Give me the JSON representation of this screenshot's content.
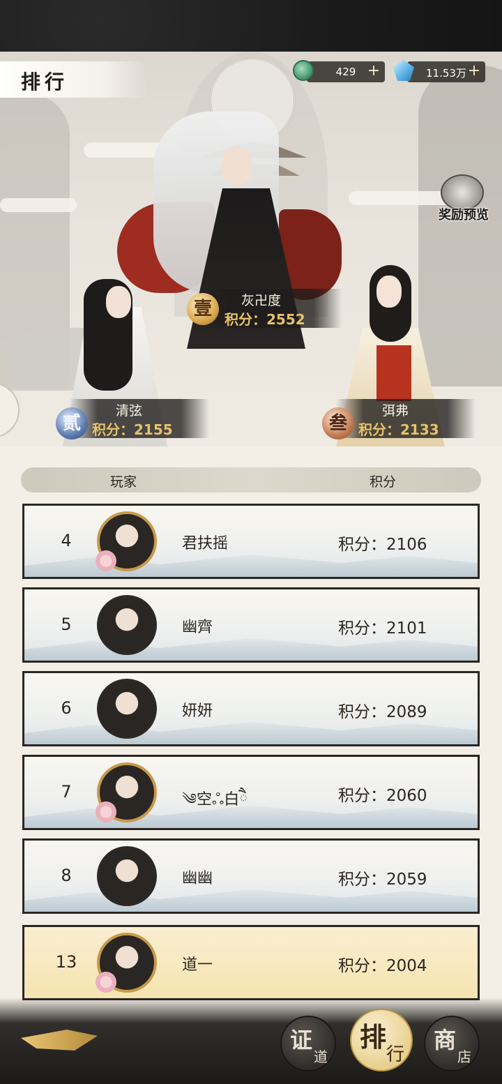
{
  "header": {
    "title": "排行"
  },
  "currencies": [
    {
      "icon": "jade-token-icon",
      "value": "429",
      "add": "+"
    },
    {
      "icon": "blue-crystal-icon",
      "value": "11.53万",
      "add": "+"
    }
  ],
  "reward_preview": {
    "label": "奖励预览",
    "icon": "gift-bag-icon"
  },
  "podium": [
    {
      "rank_glyph": "壹",
      "name": "灰卍度",
      "score": "积分：2552"
    },
    {
      "rank_glyph": "贰",
      "name": "清弦",
      "score": "积分：2155"
    },
    {
      "rank_glyph": "叁",
      "name": "弭弗",
      "score": "积分：2133"
    }
  ],
  "table": {
    "col_player": "玩家",
    "col_score": "积分",
    "rows": [
      {
        "rank": "4",
        "name": "君扶摇",
        "score_label": "积分：",
        "score": "2106"
      },
      {
        "rank": "5",
        "name": "幽齊",
        "score_label": "积分：",
        "score": "2101"
      },
      {
        "rank": "6",
        "name": "妍妍",
        "score_label": "积分：",
        "score": "2089"
      },
      {
        "rank": "7",
        "name": "༄空ஃ白ཻ",
        "score_label": "积分：",
        "score": "2060"
      },
      {
        "rank": "8",
        "name": "幽幽",
        "score_label": "积分：",
        "score": "2059"
      }
    ],
    "self_row": {
      "rank": "13",
      "name": "道一",
      "score_label": "积分：",
      "score": "2004"
    }
  },
  "nav": [
    {
      "big": "证",
      "small": "道"
    },
    {
      "big": "排",
      "small": "行"
    },
    {
      "big": "商",
      "small": "店"
    }
  ]
}
